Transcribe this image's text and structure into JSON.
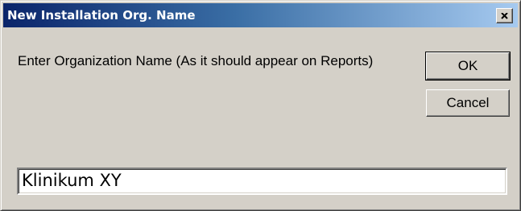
{
  "dialog": {
    "title": "New Installation Org. Name",
    "close_icon": "close-icon",
    "prompt": "Enter Organization Name (As it should appear on Reports)",
    "ok_label": "OK",
    "cancel_label": "Cancel",
    "org_name_value": "Klinikum XY"
  },
  "colors": {
    "face": "#d4d0c8",
    "title_start": "#0a246a",
    "title_end": "#a6caf0"
  }
}
